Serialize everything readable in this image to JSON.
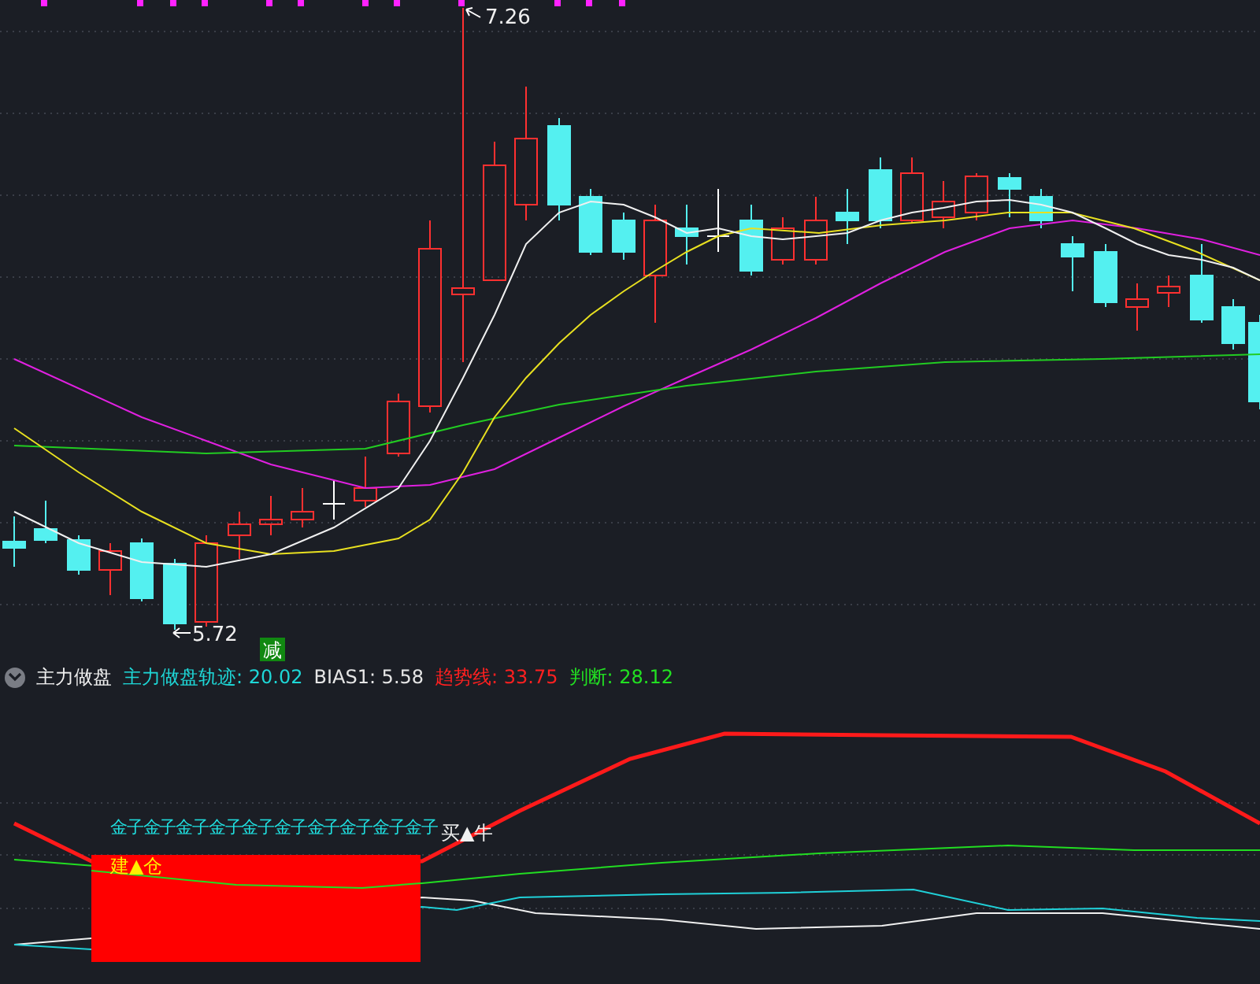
{
  "price_chart": {
    "high_label": "7.26",
    "low_label": "5.72",
    "signal_tag": "减"
  },
  "indicator": {
    "title": "主力做盘",
    "values": [
      {
        "label": "主力做盘轨迹: 20.02",
        "color": "#1ed7d7"
      },
      {
        "label": "BIAS1: 5.58",
        "color": "#e6e6e6"
      },
      {
        "label": "趋势线: 33.75",
        "color": "#ff2020"
      },
      {
        "label": "判断: 28.12",
        "color": "#22e022"
      }
    ]
  },
  "signals": {
    "gold_label": "金子金子金子金子金子金子金子金子金子金子",
    "buy_label": "买▲牛",
    "build_label": "建▲仓"
  }
}
